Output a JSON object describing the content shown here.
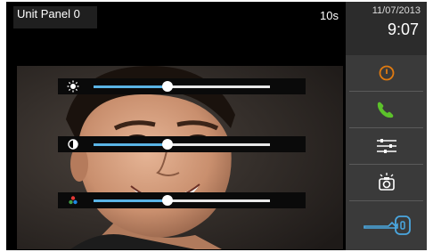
{
  "header": {
    "title": "Unit Panel 0",
    "timer": "10s"
  },
  "clock": {
    "date": "11/07/2013",
    "time": "9:07"
  },
  "sliders": [
    {
      "name": "brightness",
      "icon": "sun-icon",
      "value": 0.42
    },
    {
      "name": "contrast",
      "icon": "contrast-icon",
      "value": 0.42
    },
    {
      "name": "color",
      "icon": "color-dots-icon",
      "value": 0.42
    }
  ],
  "buttons": [
    {
      "name": "power",
      "icon": "power-icon",
      "color": "#e07a10"
    },
    {
      "name": "call",
      "icon": "phone-icon",
      "color": "#5cc12b"
    },
    {
      "name": "settings",
      "icon": "sliders-icon",
      "color": "#ffffff"
    },
    {
      "name": "camera",
      "icon": "camera-icon",
      "color": "#ffffff"
    },
    {
      "name": "door",
      "icon": "key-icon",
      "color": "#4aa7e0"
    }
  ],
  "colors": {
    "accent": "#5ab4e6",
    "panel": "#3a3a3a"
  }
}
